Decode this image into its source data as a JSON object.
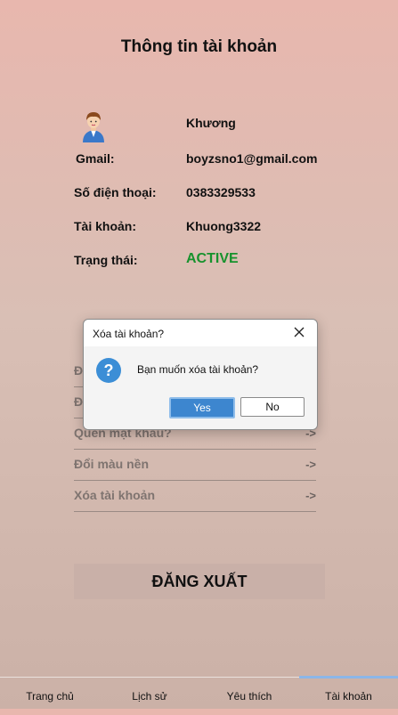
{
  "header": {
    "title": "Thông tin tài khoản"
  },
  "profile": {
    "name": "Khương",
    "gmail_label": "Gmail:",
    "gmail_value": "boyzsno1@gmail.com",
    "phone_label": "Số điện thoại:",
    "phone_value": "0383329533",
    "account_label": "Tài khoản:",
    "account_value": "Khuong3322",
    "status_label": "Trạng thái:",
    "status_value": "ACTIVE",
    "status_color": "#17922d"
  },
  "menu": {
    "items": [
      {
        "label": "Đ",
        "arrow": "->"
      },
      {
        "label": "Đ",
        "arrow": "->"
      },
      {
        "label": "Quên mật khẩu?",
        "arrow": "->"
      },
      {
        "label": "Đổi màu nền",
        "arrow": "->"
      },
      {
        "label": "Xóa tài khoản",
        "arrow": "->"
      }
    ]
  },
  "logout": {
    "label": "ĐĂNG XUẤT"
  },
  "bottom_nav": {
    "items": [
      {
        "label": "Trang chủ"
      },
      {
        "label": "Lịch sử"
      },
      {
        "label": "Yêu thích"
      },
      {
        "label": "Tài khoản"
      }
    ],
    "active": "Tài khoản",
    "active_color": "#8bb6e8"
  },
  "dialog": {
    "title": "Xóa tài khoản?",
    "message": "Bạn muốn xóa tài khoản?",
    "yes_label": "Yes",
    "no_label": "No",
    "icon": "question-icon"
  }
}
